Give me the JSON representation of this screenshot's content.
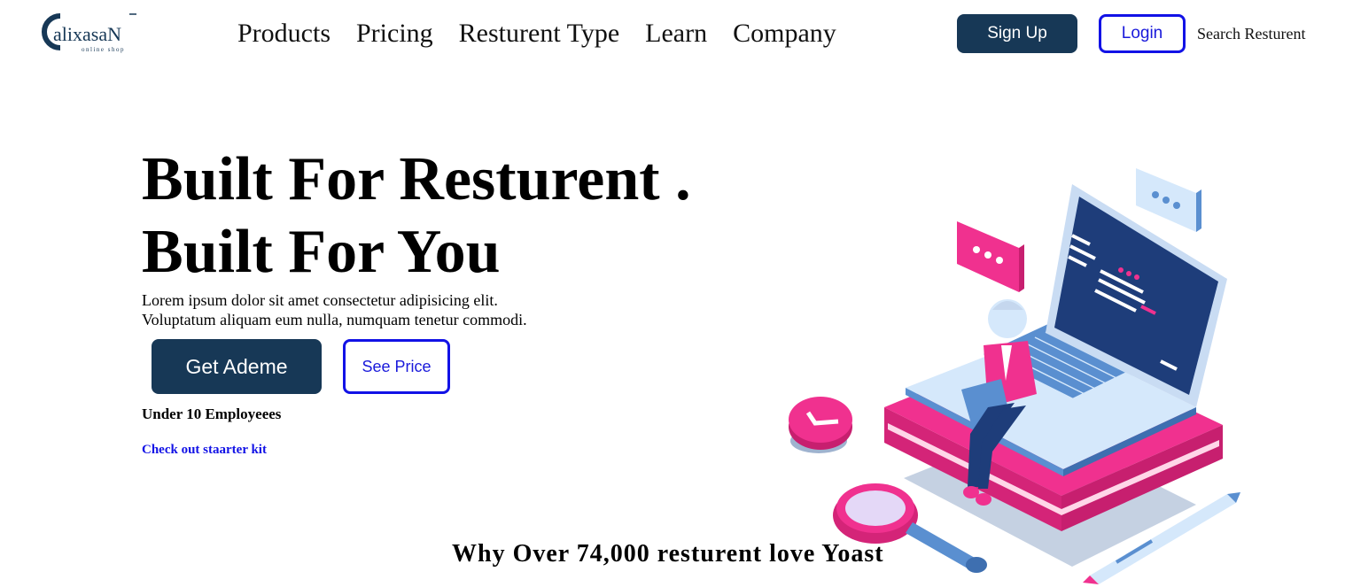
{
  "brand": {
    "name": "CalixasaN",
    "logo_letter": "C",
    "logo_rest": "alixasaN",
    "tagline": "online shop"
  },
  "nav": {
    "items": [
      "Products",
      "Pricing",
      "Resturent Type",
      "Learn",
      "Company"
    ]
  },
  "header": {
    "signup_label": "Sign Up",
    "login_label": "Login",
    "search_label": "Search Resturent"
  },
  "hero": {
    "title_line1": "Built For Resturent .",
    "title_line2": "Built For You",
    "desc_line1": "Lorem ipsum dolor sit amet consectetur adipisicing elit.",
    "desc_line2": "Voluptatum aliquam eum nulla, numquam tenetur commodi.",
    "demo_label": "Get Ademe",
    "price_label": "See Price",
    "employees_text": "Under 10 Employeees",
    "starter_link": "Check out staarter kit"
  },
  "section": {
    "why_title": "Why Over 74,000 resturent love Yoast"
  },
  "colors": {
    "primary_dark": "#173856",
    "link_blue": "#1212e6",
    "accent_pink": "#f0318f",
    "laptop_blue": "#1e3d7a",
    "light_blue": "#d5e8fb"
  },
  "illustration": {
    "name": "person-with-laptop-illustration"
  }
}
